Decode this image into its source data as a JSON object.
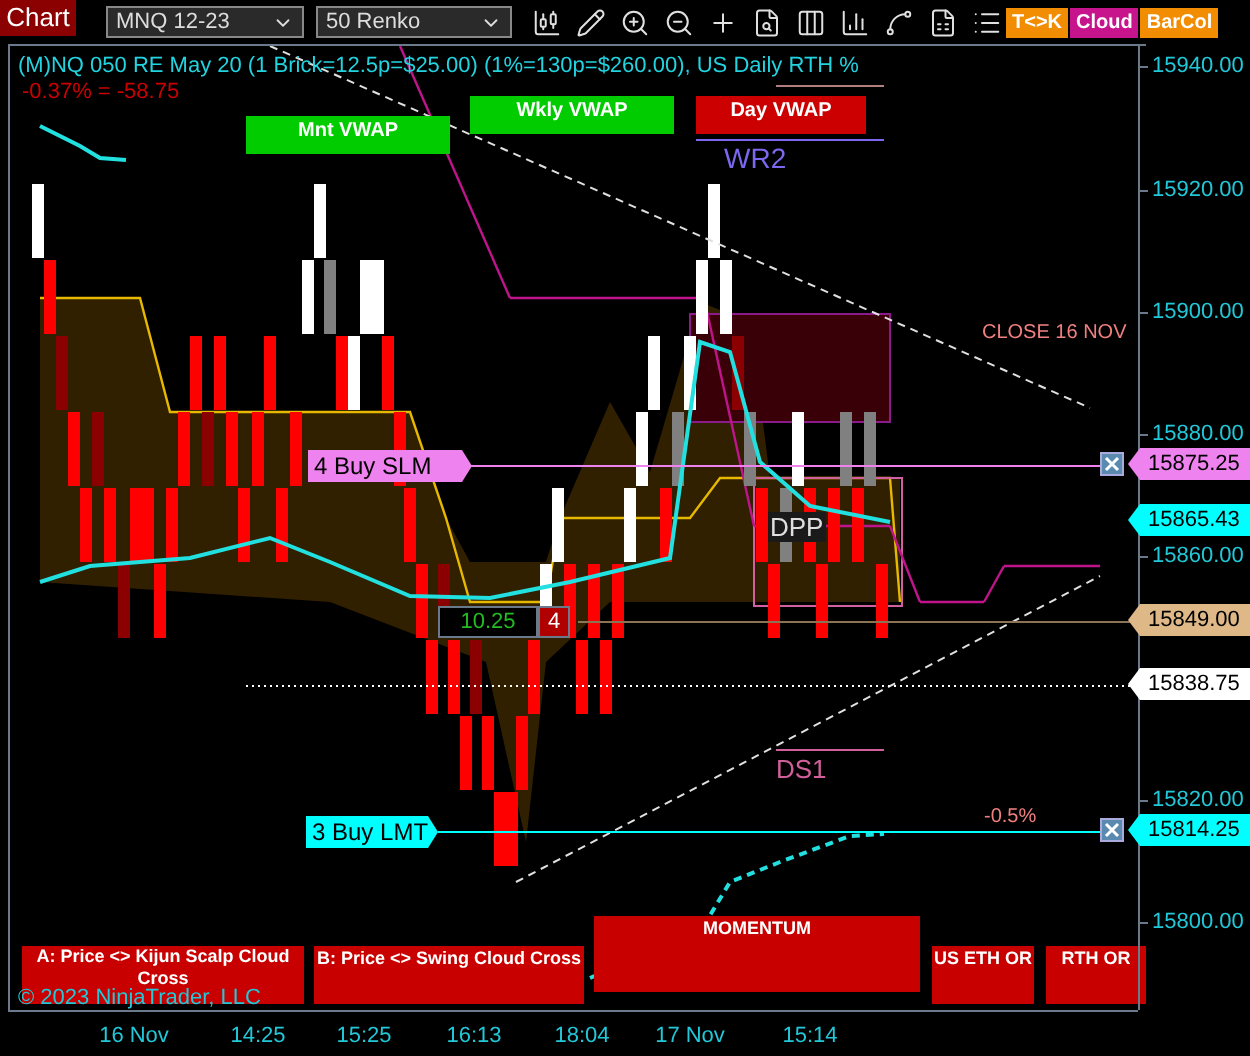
{
  "toolbar": {
    "title": "Chart",
    "instrument": "MNQ 12-23",
    "bar_type": "50 Renko",
    "badges": [
      {
        "label": "T<>K",
        "color": "#f28c00"
      },
      {
        "label": "Cloud",
        "color": "#c8148c"
      },
      {
        "label": "BarCol",
        "color": "#f28c00"
      }
    ]
  },
  "chart": {
    "header": "(M)NQ 050 RE May 20 (1 Brick=12.5p=$25.00) (1%=130p=$260.00), US Daily RTH %",
    "change": "-0.37% = -58.75",
    "vwap_boxes": [
      {
        "label": "Mnt VWAP",
        "color": "#00cc00"
      },
      {
        "label": "Wkly VWAP",
        "color": "#00cc00"
      },
      {
        "label": "Day VWAP",
        "color": "#cc0000"
      }
    ],
    "level_labels": [
      {
        "label": "WR2",
        "color": "#7b68ee"
      },
      {
        "label": "CLOSE 16 NOV",
        "color": "#f08080"
      },
      {
        "label": "DPP",
        "color": "#e0e0e0"
      },
      {
        "label": "DS1",
        "color": "#d0609a"
      },
      {
        "label": "-0.5%",
        "color": "#f08080"
      }
    ],
    "orders": [
      {
        "label": "4 Buy SLM",
        "color": "#ee82ee"
      },
      {
        "label": "3 Buy LMT",
        "color": "#00ffff"
      }
    ],
    "position": {
      "pnl": "10.25",
      "quantity": "4"
    },
    "signal_boxes": [
      {
        "label": "A: Price <> Kijun Scalp Cloud Cross"
      },
      {
        "label": "B: Price <> Swing Cloud Cross"
      },
      {
        "label": "MOMENTUM"
      },
      {
        "label": "US ETH OR"
      },
      {
        "label": "RTH OR"
      }
    ],
    "copyright": "© 2023 NinjaTrader, LLC"
  },
  "price_axis": {
    "ticks": [
      "15940.00",
      "15920.00",
      "15900.00",
      "15880.00",
      "15860.00",
      "15820.00",
      "15800.00"
    ],
    "markers": [
      {
        "value": "15875.25",
        "color": "#ee82ee"
      },
      {
        "value": "15865.43",
        "color": "#00ffff"
      },
      {
        "value": "15849.00",
        "color": "#deb887"
      },
      {
        "value": "15838.75",
        "color": "#ffffff"
      },
      {
        "value": "15814.25",
        "color": "#00ffff"
      }
    ]
  },
  "time_axis": {
    "labels": [
      "16 Nov",
      "14:25",
      "15:25",
      "16:13",
      "18:04",
      "17 Nov",
      "15:14"
    ]
  }
}
